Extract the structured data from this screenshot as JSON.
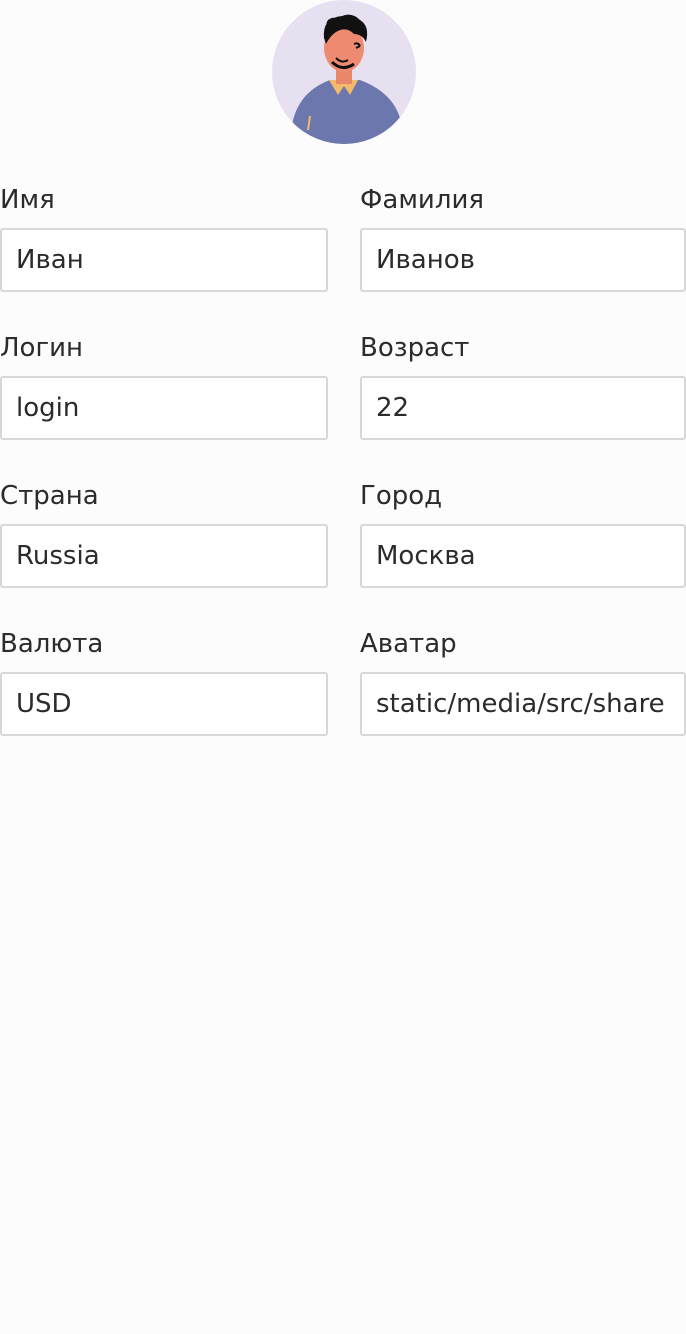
{
  "profile": {
    "avatar_icon": "user-avatar-illustration",
    "fields": [
      {
        "key": "first_name",
        "label": "Имя",
        "value": "Иван"
      },
      {
        "key": "last_name",
        "label": "Фамилия",
        "value": "Иванов"
      },
      {
        "key": "login",
        "label": "Логин",
        "value": "login"
      },
      {
        "key": "age",
        "label": "Возраст",
        "value": "22"
      },
      {
        "key": "country",
        "label": "Страна",
        "value": "Russia"
      },
      {
        "key": "city",
        "label": "Город",
        "value": "Москва"
      },
      {
        "key": "currency",
        "label": "Валюта",
        "value": "USD"
      },
      {
        "key": "avatar",
        "label": "Аватар",
        "value": "static/media/src/share"
      }
    ]
  },
  "colors": {
    "background": "#fcfcfc",
    "avatar_bg": "#e7e0f1",
    "input_border": "#d7d7d7",
    "text": "#2b2b2b"
  }
}
